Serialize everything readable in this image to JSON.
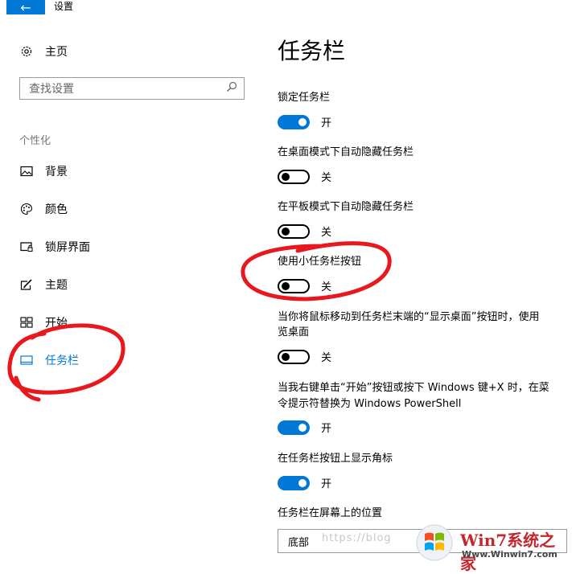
{
  "window": {
    "back_icon": "arrow-left-icon",
    "title": "设置"
  },
  "sidebar": {
    "home": {
      "icon": "gear-icon",
      "label": "主页"
    },
    "search": {
      "placeholder": "查找设置",
      "icon": "search-icon"
    },
    "section_label": "个性化",
    "items": [
      {
        "icon": "image-icon",
        "label": "背景"
      },
      {
        "icon": "palette-icon",
        "label": "颜色"
      },
      {
        "icon": "lock-screen-icon",
        "label": "锁屏界面"
      },
      {
        "icon": "theme-brush-icon",
        "label": "主题"
      },
      {
        "icon": "start-tiles-icon",
        "label": "开始"
      },
      {
        "icon": "taskbar-icon",
        "label": "任务栏",
        "active": true
      }
    ]
  },
  "main": {
    "title": "任务栏",
    "settings": [
      {
        "label": "锁定任务栏",
        "state": "开",
        "on": true
      },
      {
        "label": "在桌面模式下自动隐藏任务栏",
        "state": "关",
        "on": false
      },
      {
        "label": "在平板模式下自动隐藏任务栏",
        "state": "关",
        "on": false
      },
      {
        "label": "使用小任务栏按钮",
        "state": "关",
        "on": false
      },
      {
        "label_line1": "当你将鼠标移动到任务栏末端的“显示桌面”按钮时，使用",
        "label_line2": "览桌面",
        "state": "关",
        "on": false
      },
      {
        "label_line1": "当我右键单击“开始”按钮或按下 Windows 键+X 时，在菜",
        "label_line2": "令提示符替换为 Windows PowerShell",
        "state": "开",
        "on": true
      },
      {
        "label": "在任务栏按钮上显示角标",
        "state": "开",
        "on": true
      }
    ],
    "position": {
      "label": "任务栏在屏幕上的位置",
      "value": "底部"
    }
  },
  "watermark": {
    "text": "https://blog",
    "logo_main": "Win7系统之家",
    "logo_sub": "Www.Winwin7.com"
  },
  "colors": {
    "accent": "#0078d7",
    "annotation": "#e8191e"
  }
}
